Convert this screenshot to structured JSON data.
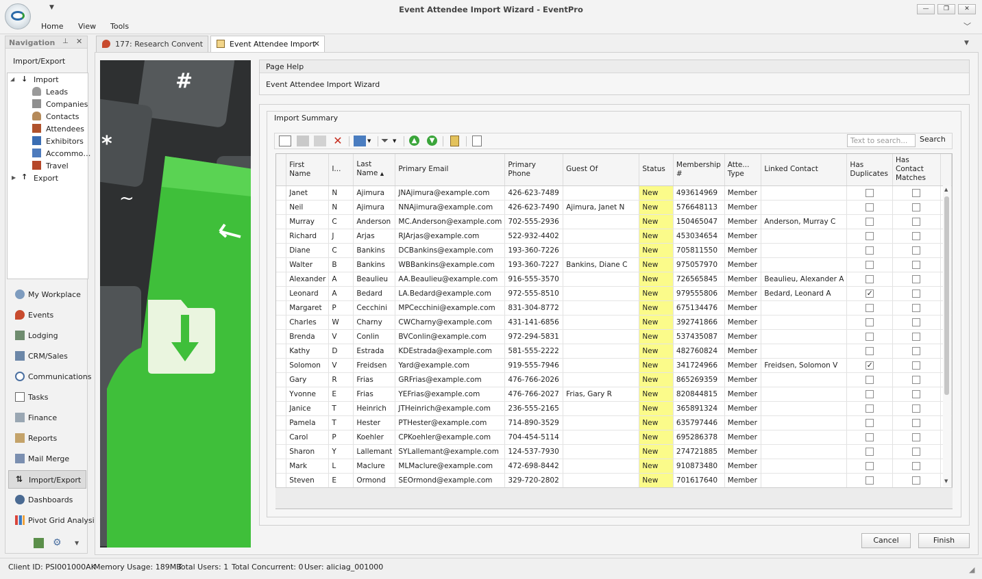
{
  "window": {
    "title": "Event Attendee Import Wizard - EventPro",
    "menu": [
      "Home",
      "View",
      "Tools"
    ],
    "controls": {
      "minimize": "—",
      "restore": "❐",
      "close": "✕"
    }
  },
  "navigation": {
    "title": "Navigation",
    "section": "Import/Export",
    "tree": {
      "import_label": "Import",
      "import_children": [
        "Leads",
        "Companies",
        "Contacts",
        "Attendees",
        "Exhibitors",
        "Accommo…",
        "Travel"
      ],
      "export_label": "Export"
    },
    "buttons": [
      "My Workplace",
      "Events",
      "Lodging",
      "CRM/Sales",
      "Communications",
      "Tasks",
      "Finance",
      "Reports",
      "Mail Merge",
      "Import/Export",
      "Dashboards",
      "Pivot Grid Analysi"
    ],
    "selected": "Import/Export"
  },
  "tabs": [
    {
      "label": "177: Research Convent",
      "active": false
    },
    {
      "label": "Event Attendee Import",
      "active": true
    }
  ],
  "page_help": {
    "header": "Page Help",
    "text": "Event Attendee Import Wizard"
  },
  "import_summary": {
    "header": "Import Summary",
    "search_placeholder": "Text to search...",
    "search_button": "Search",
    "columns": [
      "First Name",
      "I...",
      "Last Name",
      "Primary Email",
      "Primary Phone",
      "Guest Of",
      "Status",
      "Membership #",
      "Atte... Type",
      "Linked Contact",
      "Has Duplicates",
      "Has Contact Matches"
    ],
    "rows": [
      {
        "first": "Janet",
        "initial": "N",
        "last": "Ajimura",
        "email": "JNAjimura@example.com",
        "phone": "426-623-7489",
        "guest_of": "",
        "status": "New",
        "membership": "493614969",
        "type": "Member",
        "linked": "",
        "dup": false,
        "match": false
      },
      {
        "first": "Neil",
        "initial": "N",
        "last": "Ajimura",
        "email": "NNAjimura@example.com",
        "phone": "426-623-7490",
        "guest_of": "Ajimura, Janet N",
        "status": "New",
        "membership": "576648113",
        "type": "Member",
        "linked": "",
        "dup": false,
        "match": false
      },
      {
        "first": "Murray",
        "initial": "C",
        "last": "Anderson",
        "email": "MC.Anderson@example.com",
        "phone": "702-555-2936",
        "guest_of": "",
        "status": "New",
        "membership": "150465047",
        "type": "Member",
        "linked": "Anderson, Murray C",
        "dup": false,
        "match": false
      },
      {
        "first": "Richard",
        "initial": "J",
        "last": "Arjas",
        "email": "RJArjas@example.com",
        "phone": "522-932-4402",
        "guest_of": "",
        "status": "New",
        "membership": "453034654",
        "type": "Member",
        "linked": "",
        "dup": false,
        "match": false
      },
      {
        "first": "Diane",
        "initial": "C",
        "last": "Bankins",
        "email": "DCBankins@example.com",
        "phone": "193-360-7226",
        "guest_of": "",
        "status": "New",
        "membership": "705811550",
        "type": "Member",
        "linked": "",
        "dup": false,
        "match": false
      },
      {
        "first": "Walter",
        "initial": "B",
        "last": "Bankins",
        "email": "WBBankins@example.com",
        "phone": "193-360-7227",
        "guest_of": "Bankins, Diane C",
        "status": "New",
        "membership": "975057970",
        "type": "Member",
        "linked": "",
        "dup": false,
        "match": false
      },
      {
        "first": "Alexander",
        "initial": "A",
        "last": "Beaulieu",
        "email": "AA.Beaulieu@example.com",
        "phone": "916-555-3570",
        "guest_of": "",
        "status": "New",
        "membership": "726565845",
        "type": "Member",
        "linked": "Beaulieu, Alexander A",
        "dup": false,
        "match": false
      },
      {
        "first": "Leonard",
        "initial": "A",
        "last": "Bedard",
        "email": "LA.Bedard@example.com",
        "phone": "972-555-8510",
        "guest_of": "",
        "status": "New",
        "membership": "979555806",
        "type": "Member",
        "linked": "Bedard, Leonard A",
        "dup": true,
        "match": false
      },
      {
        "first": "Margaret",
        "initial": "P",
        "last": "Cecchini",
        "email": "MPCecchini@example.com",
        "phone": "831-304-8772",
        "guest_of": "",
        "status": "New",
        "membership": "675134476",
        "type": "Member",
        "linked": "",
        "dup": false,
        "match": false
      },
      {
        "first": "Charles",
        "initial": "W",
        "last": "Charny",
        "email": "CWCharny@example.com",
        "phone": "431-141-6856",
        "guest_of": "",
        "status": "New",
        "membership": "392741866",
        "type": "Member",
        "linked": "",
        "dup": false,
        "match": false
      },
      {
        "first": "Brenda",
        "initial": "V",
        "last": "Conlin",
        "email": "BVConlin@example.com",
        "phone": "972-294-5831",
        "guest_of": "",
        "status": "New",
        "membership": "537435087",
        "type": "Member",
        "linked": "",
        "dup": false,
        "match": false
      },
      {
        "first": "Kathy",
        "initial": "D",
        "last": "Estrada",
        "email": "KDEstrada@example.com",
        "phone": "581-555-2222",
        "guest_of": "",
        "status": "New",
        "membership": "482760824",
        "type": "Member",
        "linked": "",
        "dup": false,
        "match": false
      },
      {
        "first": "Solomon",
        "initial": "V",
        "last": "Freidsen",
        "email": "Yard@example.com",
        "phone": "919-555-7946",
        "guest_of": "",
        "status": "New",
        "membership": "341724966",
        "type": "Member",
        "linked": "Freidsen, Solomon V",
        "dup": true,
        "match": false
      },
      {
        "first": "Gary",
        "initial": "R",
        "last": "Frias",
        "email": "GRFrias@example.com",
        "phone": "476-766-2026",
        "guest_of": "",
        "status": "New",
        "membership": "865269359",
        "type": "Member",
        "linked": "",
        "dup": false,
        "match": false
      },
      {
        "first": "Yvonne",
        "initial": "E",
        "last": "Frias",
        "email": "YEFrias@example.com",
        "phone": "476-766-2027",
        "guest_of": "Frias, Gary R",
        "status": "New",
        "membership": "820844815",
        "type": "Member",
        "linked": "",
        "dup": false,
        "match": false
      },
      {
        "first": "Janice",
        "initial": "T",
        "last": "Heinrich",
        "email": "JTHeinrich@example.com",
        "phone": "236-555-2165",
        "guest_of": "",
        "status": "New",
        "membership": "365891324",
        "type": "Member",
        "linked": "",
        "dup": false,
        "match": false
      },
      {
        "first": "Pamela",
        "initial": "T",
        "last": "Hester",
        "email": "PTHester@example.com",
        "phone": "714-890-3529",
        "guest_of": "",
        "status": "New",
        "membership": "635797446",
        "type": "Member",
        "linked": "",
        "dup": false,
        "match": false
      },
      {
        "first": "Carol",
        "initial": "P",
        "last": "Koehler",
        "email": "CPKoehler@example.com",
        "phone": "704-454-5114",
        "guest_of": "",
        "status": "New",
        "membership": "695286378",
        "type": "Member",
        "linked": "",
        "dup": false,
        "match": false
      },
      {
        "first": "Sharon",
        "initial": "Y",
        "last": "Lallemant",
        "email": "SYLallemant@example.com",
        "phone": "124-537-7930",
        "guest_of": "",
        "status": "New",
        "membership": "274721885",
        "type": "Member",
        "linked": "",
        "dup": false,
        "match": false
      },
      {
        "first": "Mark",
        "initial": "L",
        "last": "Maclure",
        "email": "MLMaclure@example.com",
        "phone": "472-698-8442",
        "guest_of": "",
        "status": "New",
        "membership": "910873480",
        "type": "Member",
        "linked": "",
        "dup": false,
        "match": false
      },
      {
        "first": "Steven",
        "initial": "E",
        "last": "Ormond",
        "email": "SEOrmond@example.com",
        "phone": "329-720-2802",
        "guest_of": "",
        "status": "New",
        "membership": "701617640",
        "type": "Member",
        "linked": "",
        "dup": false,
        "match": false
      }
    ]
  },
  "buttons": {
    "cancel": "Cancel",
    "finish": "Finish"
  },
  "statusbar": {
    "client_id": "Client ID: PSI001000AK",
    "memory": "Memory Usage: 189MB",
    "total_users": "Total Users: 1",
    "concurrent": "Total Concurrent: 0",
    "user": "User: aliciag_001000"
  },
  "colors": {
    "status_highlight": "#fbfb8a",
    "hero_green": "#3fbf3a",
    "accent": "#2b6aa8"
  }
}
